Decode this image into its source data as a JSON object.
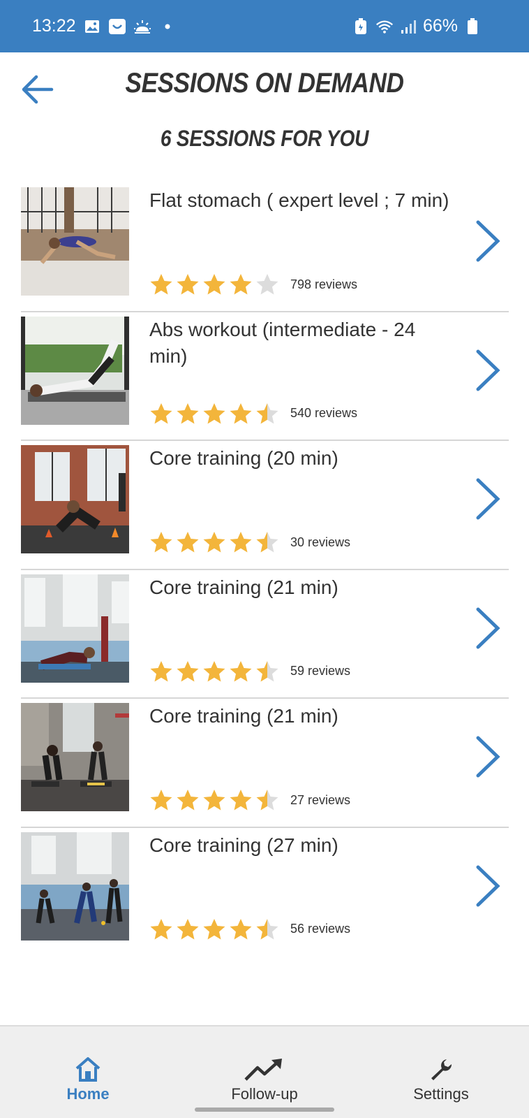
{
  "status_bar": {
    "time": "13:22",
    "battery": "66%",
    "icons": [
      "gallery-icon",
      "notification-icon",
      "weather-icon",
      "dot-icon",
      "battery-saver-icon",
      "wifi-icon",
      "signal-icon",
      "battery-icon"
    ]
  },
  "header": {
    "title": "SESSIONS ON DEMAND",
    "subtitle": "6 SESSIONS FOR YOU"
  },
  "accent_color": "#3a7fc1",
  "star_color": "#f3b53b",
  "sessions": [
    {
      "title": "Flat stomach ( expert level ; 7 min)",
      "rating": 4.0,
      "reviews": "798 reviews"
    },
    {
      "title": "Abs workout (intermediate - 24 min)",
      "rating": 4.5,
      "reviews": "540 reviews"
    },
    {
      "title": "Core training (20 min)",
      "rating": 4.5,
      "reviews": "30 reviews"
    },
    {
      "title": "Core training (21 min)",
      "rating": 4.5,
      "reviews": "59 reviews"
    },
    {
      "title": "Core training (21 min)",
      "rating": 4.5,
      "reviews": "27 reviews"
    },
    {
      "title": "Core training (27 min)",
      "rating": 4.5,
      "reviews": "56 reviews"
    }
  ],
  "bottom_nav": {
    "items": [
      {
        "label": "Home",
        "icon": "home-icon",
        "active": true
      },
      {
        "label": "Follow-up",
        "icon": "trend-icon",
        "active": false
      },
      {
        "label": "Settings",
        "icon": "wrench-icon",
        "active": false
      }
    ]
  }
}
